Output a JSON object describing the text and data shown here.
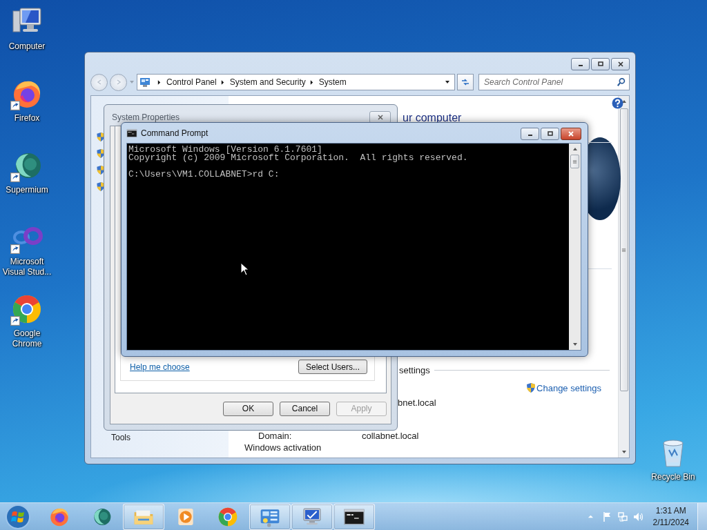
{
  "desktop_icons": [
    {
      "kind": "computer",
      "label": "Computer",
      "shortcut": false
    },
    {
      "kind": "firefox",
      "label": "Firefox",
      "shortcut": true
    },
    {
      "kind": "supermium",
      "label": "Supermium",
      "shortcut": true
    },
    {
      "kind": "visual-studio",
      "label": "Microsoft Visual Stud...",
      "shortcut": true
    },
    {
      "kind": "chrome",
      "label": "Google Chrome",
      "shortcut": true
    }
  ],
  "recycle_bin": {
    "label": "Recycle Bin"
  },
  "control_panel": {
    "breadcrumb": [
      "Control Panel",
      "System and Security",
      "System"
    ],
    "search": {
      "placeholder": "Search Control Panel"
    },
    "heading": "ur computer",
    "left_links": [
      "Tools"
    ],
    "section_heading": "settings",
    "change_settings": "Change settings",
    "partial_value": "bnet.local",
    "fields": [
      {
        "label": "Domain:",
        "value": "collabnet.local"
      }
    ],
    "next_section": "Windows activation"
  },
  "system_properties": {
    "title": "System Properties",
    "help_link": "Help me choose",
    "select_users": "Select Users...",
    "buttons": [
      {
        "label": "OK",
        "disabled": false
      },
      {
        "label": "Cancel",
        "disabled": false
      },
      {
        "label": "Apply",
        "disabled": true
      }
    ]
  },
  "command_prompt": {
    "title": "Command Prompt",
    "output": [
      "Microsoft Windows [Version 6.1.7601]",
      "Copyright (c) 2009 Microsoft Corporation.  All rights reserved."
    ],
    "prompt": "C:\\Users\\VM1.COLLABNET>rd C:"
  },
  "taskbar": {
    "items": [
      {
        "kind": "firefox",
        "open": false
      },
      {
        "kind": "supermium",
        "open": false
      },
      {
        "kind": "explorer",
        "open": true
      },
      {
        "kind": "media",
        "open": false
      },
      {
        "kind": "chrome",
        "open": false
      },
      {
        "kind": "control-panel",
        "open": true
      },
      {
        "kind": "system",
        "open": true
      },
      {
        "kind": "cmd",
        "open": true
      }
    ],
    "time": "1:31 AM",
    "date": "2/11/2024"
  }
}
